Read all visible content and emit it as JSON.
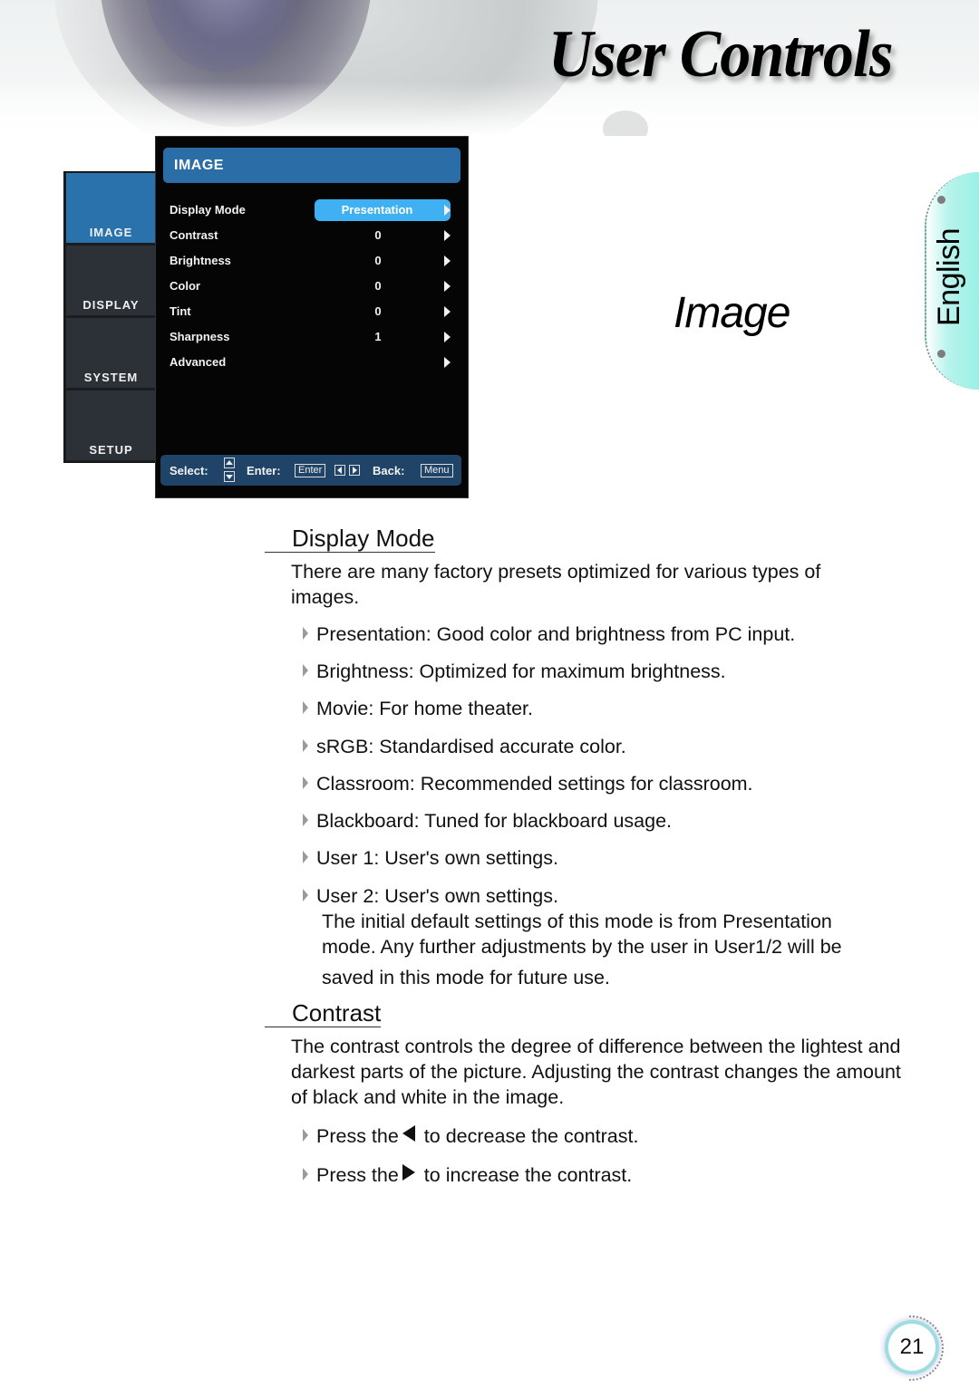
{
  "header": {
    "title": "User Controls"
  },
  "osd": {
    "sidebar": [
      {
        "label": "IMAGE",
        "active": true
      },
      {
        "label": "DISPLAY",
        "active": false
      },
      {
        "label": "SYSTEM",
        "active": false
      },
      {
        "label": "SETUP",
        "active": false
      }
    ],
    "panel_title": "IMAGE",
    "rows": [
      {
        "label": "Display Mode",
        "value": "Presentation",
        "selected": true
      },
      {
        "label": "Contrast",
        "value": "0"
      },
      {
        "label": "Brightness",
        "value": "0"
      },
      {
        "label": "Color",
        "value": "0"
      },
      {
        "label": "Tint",
        "value": "0"
      },
      {
        "label": "Sharpness",
        "value": "1"
      },
      {
        "label": "Advanced",
        "value": ""
      }
    ],
    "footer": {
      "select_label": "Select:",
      "enter_label": "Enter:",
      "enter_key": "Enter",
      "back_label": "Back:",
      "back_key": "Menu"
    },
    "colors": {
      "active_tab": "#2a72ac",
      "header_bar": "#2b6ea7",
      "selected_pill": "#3fb1f3",
      "footer_bar": "#1f4468"
    }
  },
  "section_title": "Image",
  "language_tab": "English",
  "display_mode": {
    "heading": "Display Mode",
    "intro": "There are many factory presets optimized for various types of images.",
    "items": [
      "Presentation: Good color and brightness from PC input.",
      "Brightness: Optimized for maximum brightness.",
      "Movie: For home theater.",
      "sRGB: Standardised accurate color.",
      "Classroom: Recommended settings for classroom.",
      "Blackboard: Tuned for blackboard usage.",
      "User 1: User's own settings.",
      "User 2: User's own settings."
    ],
    "note_line1": "The initial default settings of this mode is from Presentation",
    "note_line2": "mode. Any further adjustments by the user in User1/2 will be",
    "note_line3": "saved in this mode for future use."
  },
  "contrast": {
    "heading": "Contrast",
    "intro": "The contrast controls the degree of difference between the lightest and darkest parts of the picture. Adjusting the contrast changes the amount of black and white in the image.",
    "decrease_pre": "Press the",
    "decrease_post": "to decrease the contrast.",
    "increase_pre": "Press the",
    "increase_post": "to increase the contrast."
  },
  "page_number": "21"
}
